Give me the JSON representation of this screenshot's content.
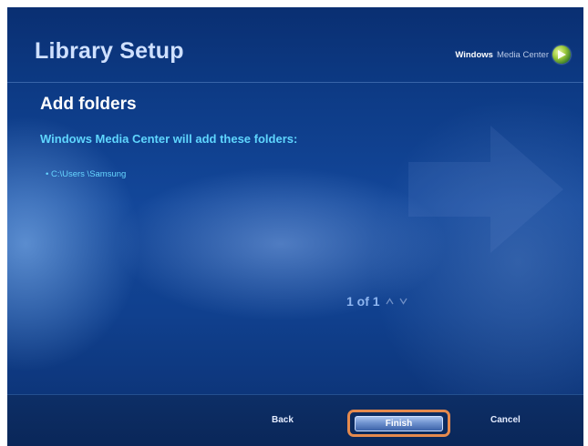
{
  "header": {
    "title": "Library Setup",
    "brand_bold": "Windows",
    "brand_rest": "Media Center"
  },
  "content": {
    "heading": "Add folders",
    "subtitle": "Windows Media Center will add these folders:",
    "folders": [
      "• C:\\Users \\Samsung"
    ]
  },
  "pager": {
    "text": "1 of 1"
  },
  "footer": {
    "back_label": "Back",
    "finish_label": "Finish",
    "cancel_label": "Cancel"
  },
  "colors": {
    "highlight_border": "#e58a4e",
    "accent_text": "#5fd6ff"
  }
}
